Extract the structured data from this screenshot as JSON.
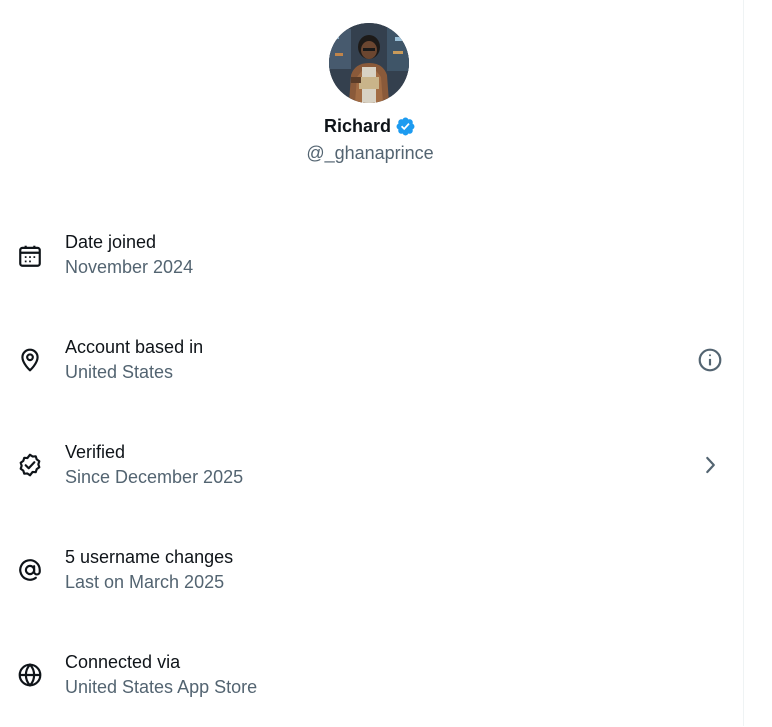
{
  "profile": {
    "name": "Richard",
    "handle": "@_ghanaprince",
    "verified": true,
    "badge_color": "#1d9bf0"
  },
  "details": [
    {
      "label": "Date joined",
      "value": "November 2024",
      "icon": "calendar-icon"
    },
    {
      "label": "Account based in",
      "value": "United States",
      "icon": "location-pin-icon",
      "trailing_icon": "info-icon"
    },
    {
      "label": "Verified",
      "value": "Since December 2025",
      "icon": "verified-badge-icon",
      "trailing_icon": "chevron-right-icon"
    },
    {
      "label": "5 username changes",
      "value": "Last on March 2025",
      "icon": "at-sign-icon"
    },
    {
      "label": "Connected via",
      "value": "United States App Store",
      "icon": "globe-icon"
    }
  ],
  "colors": {
    "primary_text": "#0f1419",
    "secondary_text": "#536471",
    "accent": "#1d9bf0",
    "divider": "#eff3f4"
  }
}
